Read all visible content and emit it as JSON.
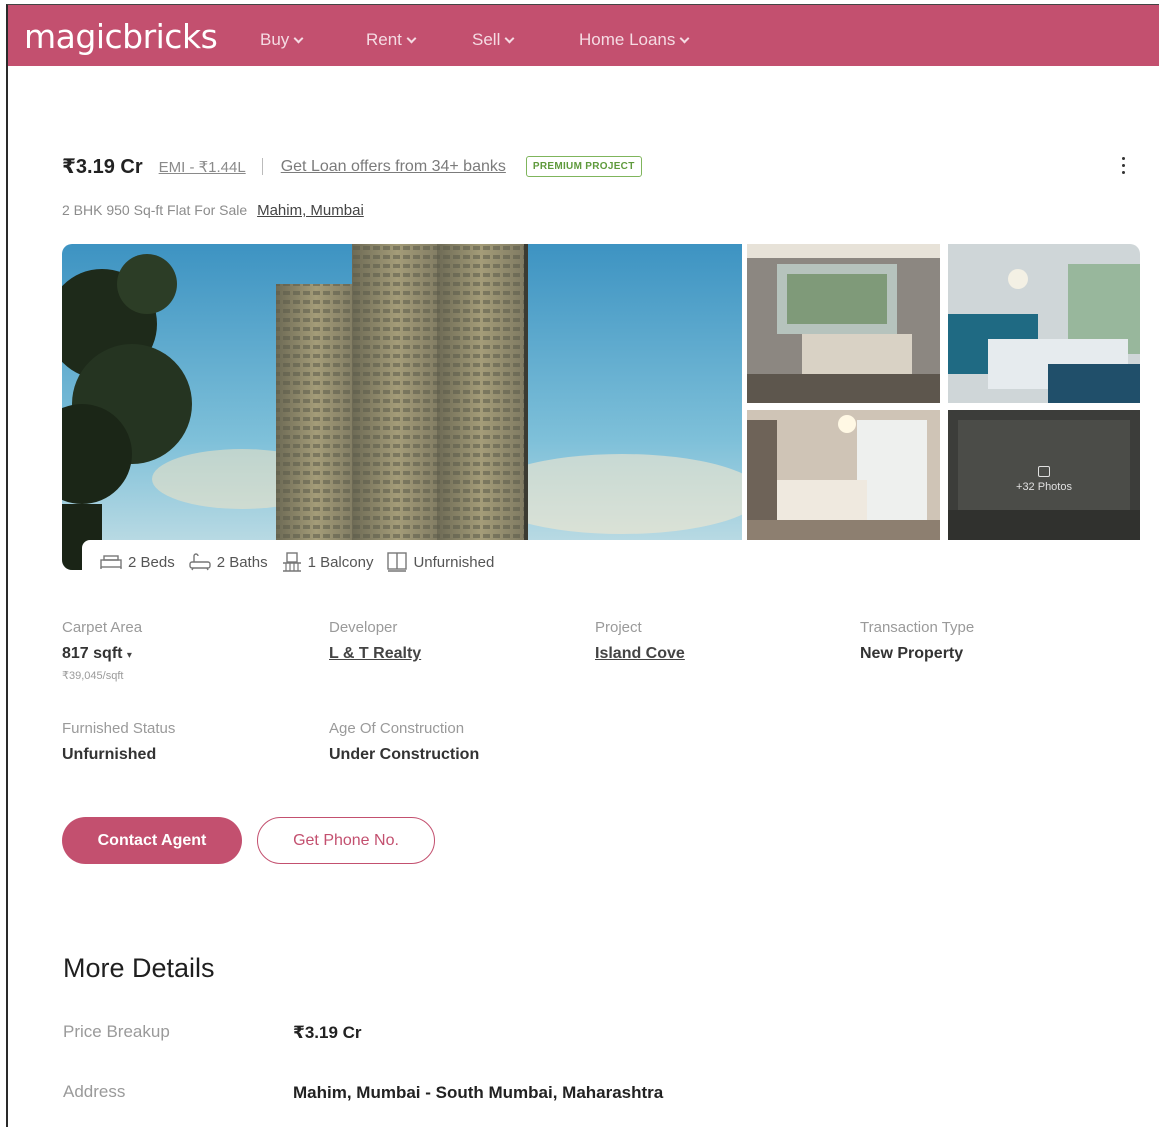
{
  "header": {
    "logo": "magicbricks",
    "nav": [
      {
        "label": "Buy"
      },
      {
        "label": "Rent"
      },
      {
        "label": "Sell"
      },
      {
        "label": "Home Loans"
      }
    ]
  },
  "listing": {
    "price": "₹3.19 Cr",
    "emi": "EMI - ₹1.44L",
    "loan_offers": "Get Loan offers from 34+ banks",
    "badge": "PREMIUM PROJECT",
    "subtitle": "2 BHK 950 Sq-ft Flat For Sale",
    "location": "Mahim, Mumbai"
  },
  "gallery": {
    "photos_count": "+32 Photos"
  },
  "amenities": [
    {
      "icon": "bed-icon",
      "label": "2 Beds"
    },
    {
      "icon": "bath-icon",
      "label": "2 Baths"
    },
    {
      "icon": "balcony-icon",
      "label": "1 Balcony"
    },
    {
      "icon": "furnishing-icon",
      "label": "Unfurnished"
    }
  ],
  "details": {
    "carpet_area": {
      "label": "Carpet Area",
      "value": "817 sqft",
      "sub": "₹39,045/sqft"
    },
    "developer": {
      "label": "Developer",
      "value": "L & T Realty"
    },
    "project": {
      "label": "Project",
      "value": "Island Cove"
    },
    "transaction": {
      "label": "Transaction Type",
      "value": "New Property"
    },
    "furnished": {
      "label": "Furnished Status",
      "value": "Unfurnished"
    },
    "age": {
      "label": "Age Of Construction",
      "value": "Under Construction"
    }
  },
  "actions": {
    "contact": "Contact Agent",
    "phone": "Get Phone No."
  },
  "more_details": {
    "title": "More Details",
    "rows": [
      {
        "label": "Price Breakup",
        "value": "₹3.19 Cr"
      },
      {
        "label": "Address",
        "value": "Mahim, Mumbai - South Mumbai, Maharashtra"
      }
    ]
  },
  "colors": {
    "brand": "#c3506f",
    "badge_green": "#5f9a3c"
  }
}
